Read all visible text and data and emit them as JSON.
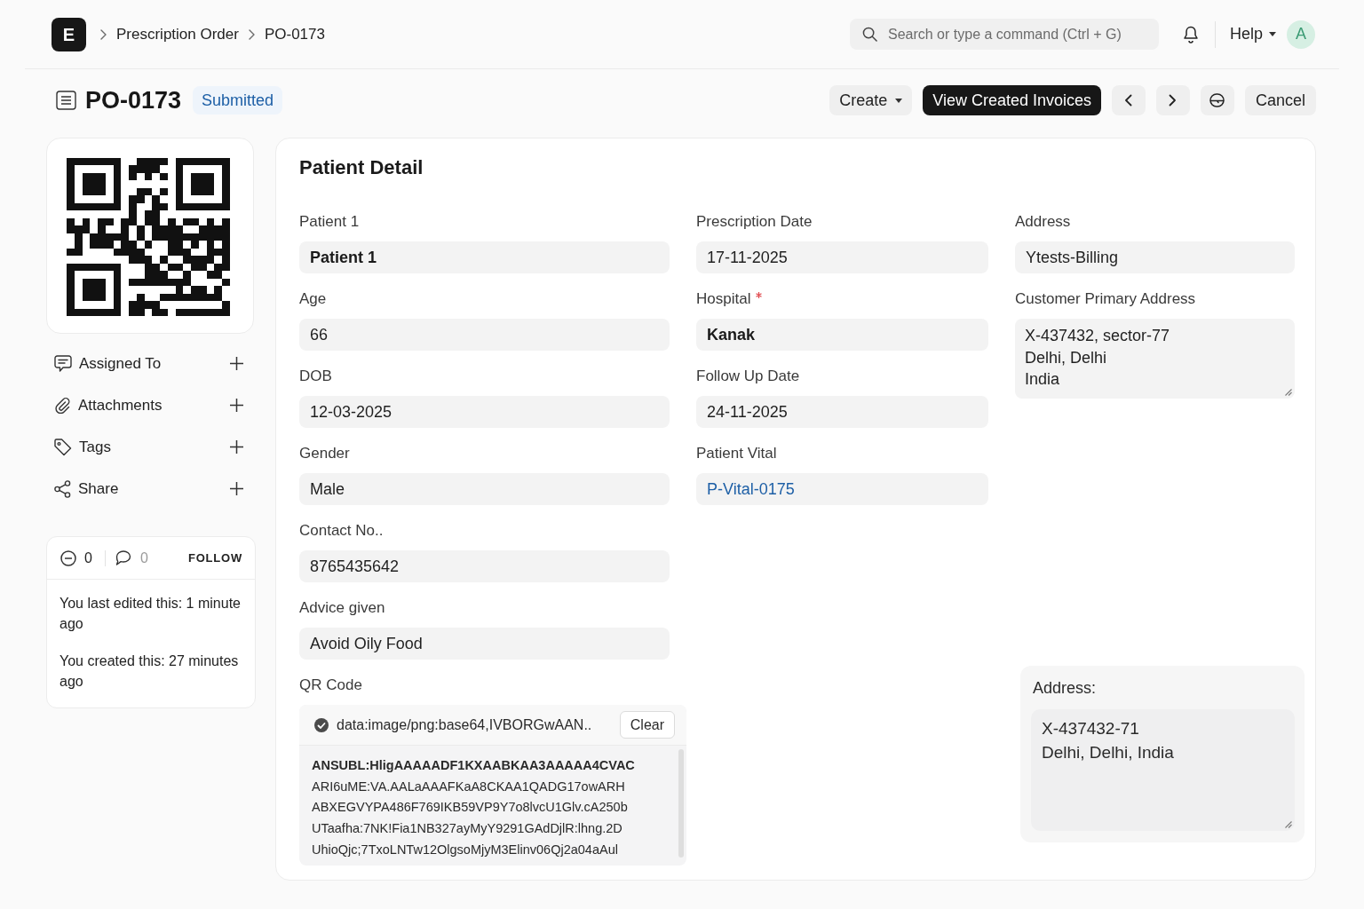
{
  "navbar": {
    "logo": "E",
    "breadcrumbs": [
      "Prescription Order",
      "PO-0173"
    ],
    "search": {
      "placeholder": "Search or type a command (Ctrl + G)"
    },
    "help": "Help",
    "avatar": "A"
  },
  "page_header": {
    "title": "PO-0173",
    "status": "Submitted",
    "actions": [
      {
        "kind": "dropdown",
        "label": "Create"
      },
      {
        "kind": "primary",
        "label": "View Created Invoices"
      },
      {
        "kind": "previous"
      },
      {
        "kind": "next"
      },
      {
        "kind": "print"
      },
      {
        "kind": "default",
        "label": "Cancel"
      }
    ]
  },
  "sidebar": {
    "items": [
      {
        "kind": "assign",
        "label": "Assigned To"
      },
      {
        "kind": "attachment",
        "label": "Attachments"
      },
      {
        "kind": "tag",
        "label": "Tags"
      },
      {
        "kind": "share",
        "label": "Share"
      }
    ],
    "activity": {
      "likes": "0",
      "comments": "0",
      "follow": "FOLLOW",
      "entries": [
        "You last edited this: 1 minute ago",
        "You created this: 27 minutes ago"
      ]
    }
  },
  "form": {
    "section_title": "Patient Detail",
    "columns": [
      {
        "fields": [
          {
            "label": "Patient 1",
            "kind": "strong",
            "value": "Patient 1",
            "required": false
          },
          {
            "label": "Age",
            "kind": "data",
            "value": "66",
            "required": false
          },
          {
            "label": "DOB",
            "kind": "data",
            "value": "12-03-2025",
            "required": false
          },
          {
            "label": "Gender",
            "kind": "data",
            "value": "Male",
            "required": false
          },
          {
            "label": "Contact No..",
            "kind": "data",
            "value": "8765435642",
            "required": false
          },
          {
            "label": "Advice given",
            "kind": "data",
            "value": "Avoid Oily Food",
            "required": false
          },
          {
            "label": "QR Code",
            "kind": "attach",
            "value": "data:image/png:base64,IVBORGwAAN..",
            "button": "Clear",
            "required": false,
            "preview": [
              "ANSUBL:HligAAAAADF1KXAABKAA3AAAAA4CVAC",
              "ARI6uME:VA.AALaAAAFKaA8CKAA1QADG17owARH",
              "ABXEGVYPA486F769IKB59VP9Y7o8lvcU1Glv.cA250b",
              "UTaafha:7NK!Fia1NB327ayMyY9291GAdDjlR:lhng.2D",
              "UhioQjc;7TxoLNTw12OlgsoMjyM3Elinv06Qj2a04aAul"
            ]
          }
        ]
      },
      {
        "fields": [
          {
            "label": "Prescription Date",
            "kind": "data",
            "value": "17-11-2025",
            "required": false
          },
          {
            "label": "Hospital",
            "kind": "strong",
            "value": "Kanak",
            "required": true
          },
          {
            "label": "Follow Up Date",
            "kind": "data",
            "value": "24-11-2025",
            "required": false
          },
          {
            "label": "Patient Vital",
            "kind": "link",
            "value": "P-Vital-0175",
            "required": false
          }
        ]
      },
      {
        "fields": [
          {
            "label": "Address",
            "kind": "data",
            "value": "Ytests-Billing",
            "required": false
          },
          {
            "label": "Customer Primary Address",
            "kind": "textarea",
            "lines": [
              "X-437432, sector-77",
              "Delhi, Delhi",
              "India"
            ],
            "required": false
          }
        ]
      }
    ],
    "address_display": {
      "label": "Address:",
      "lines": [
        "X-437432-71",
        "Delhi, Delhi, India"
      ]
    }
  }
}
